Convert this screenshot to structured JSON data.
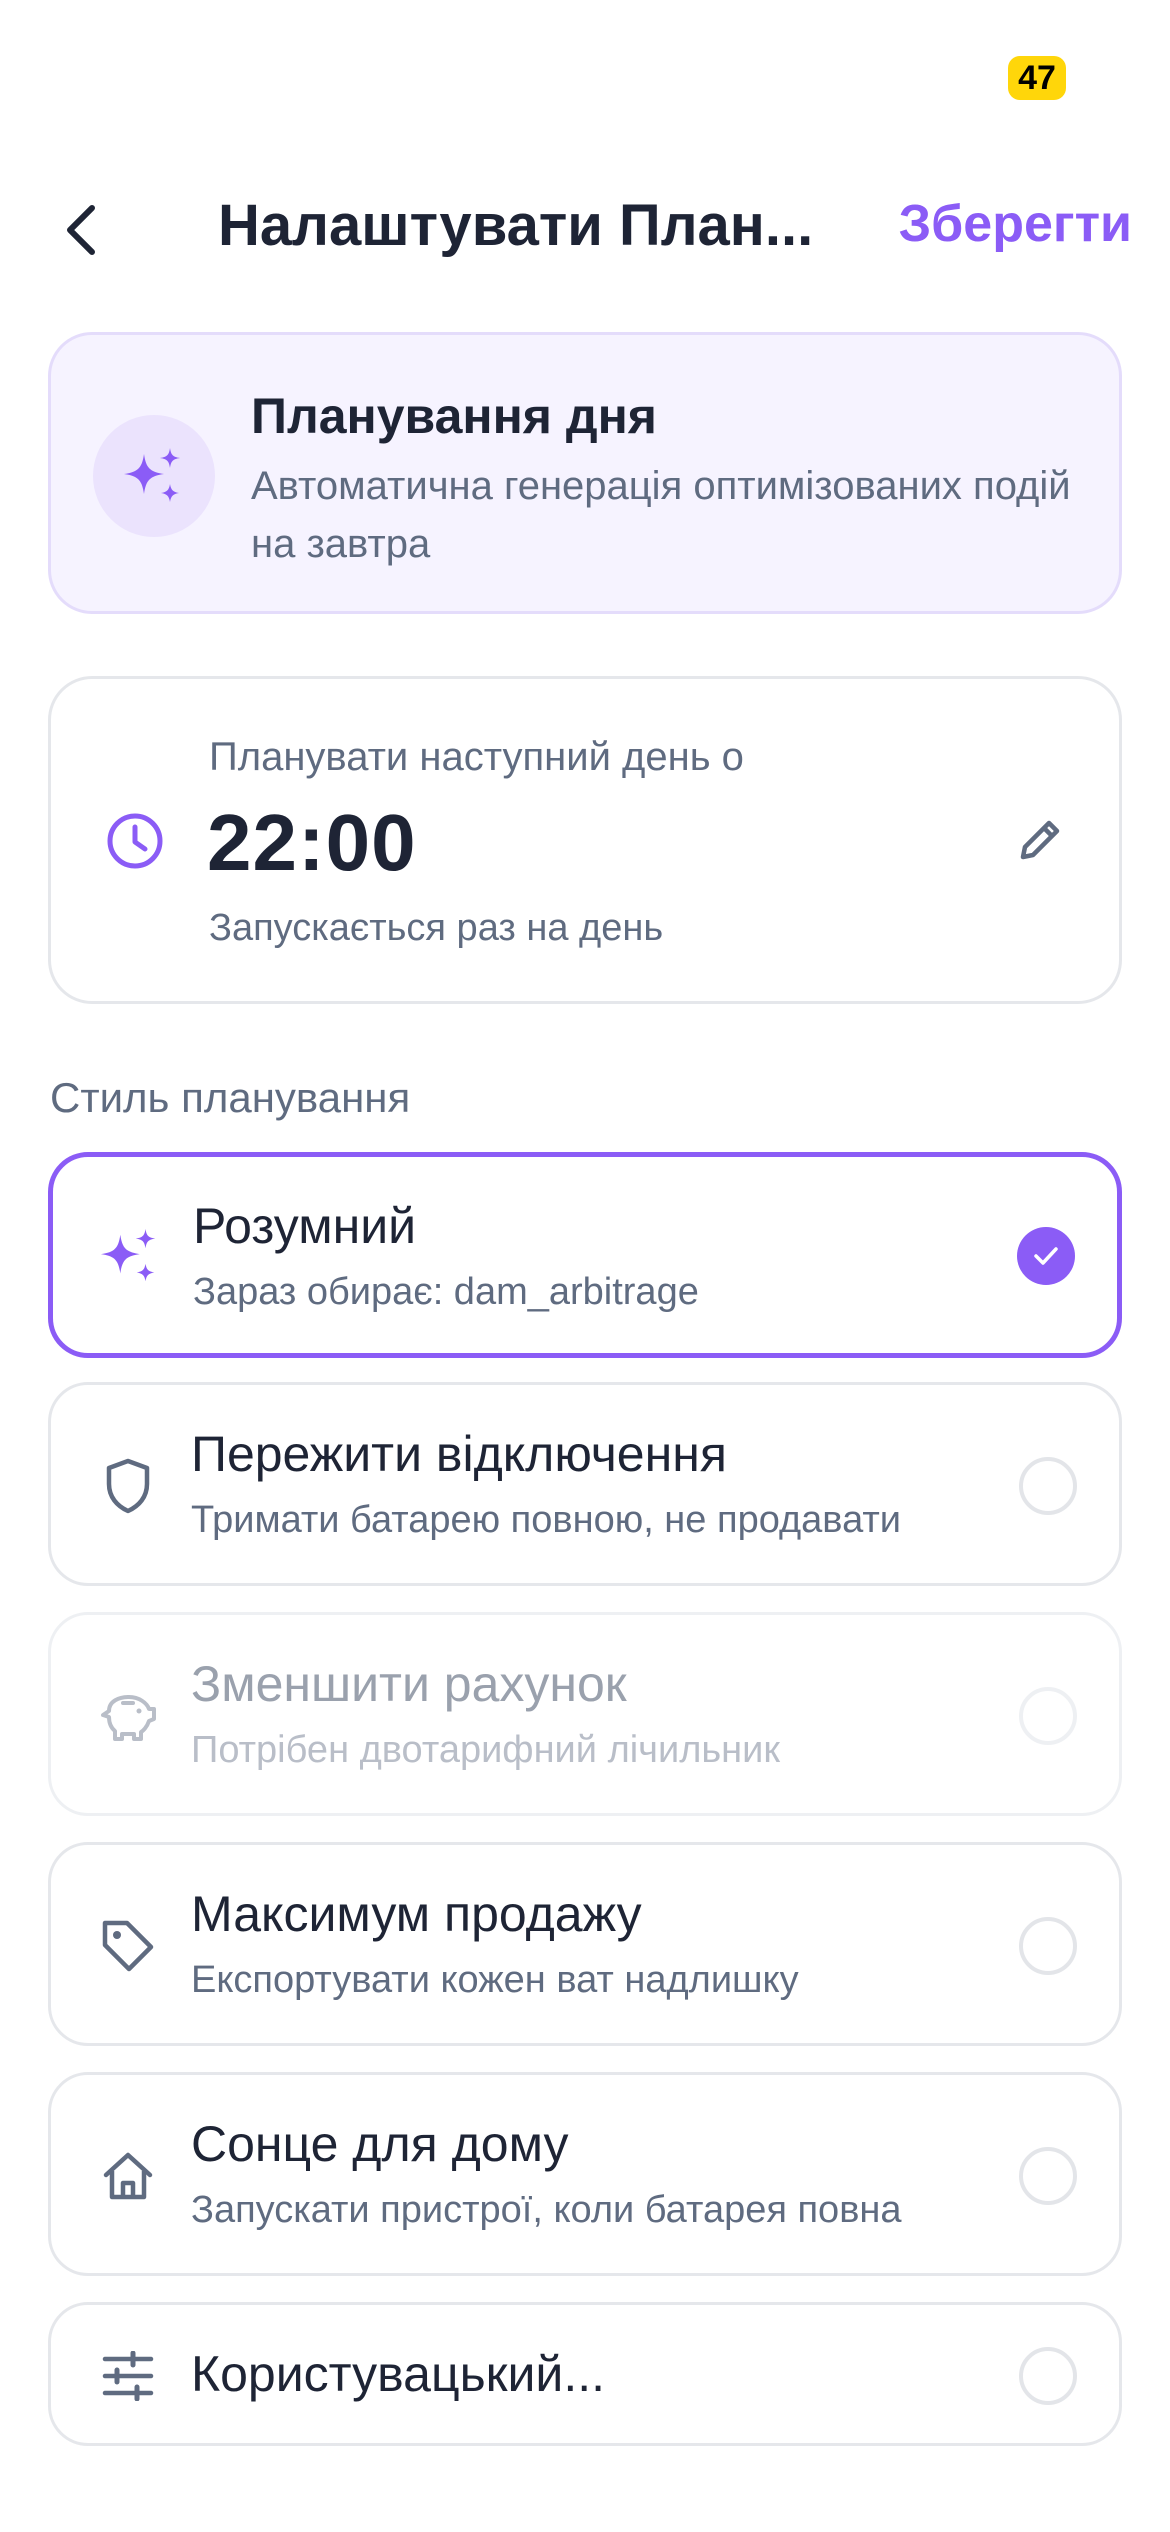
{
  "status_bar": {
    "battery": "47",
    "battery_color": "#ffd60a"
  },
  "nav": {
    "back_icon": "chevron-left-icon",
    "title": "Налаштувати План...",
    "save_label": "Зберегти"
  },
  "info_card": {
    "icon": "sparkles-icon",
    "title": "Планування дня",
    "description": "Автоматична генерація оптимізованих подій на завтра"
  },
  "schedule": {
    "icon": "clock-icon",
    "label": "Планувати наступний день о",
    "time": "22:00",
    "frequency": "Запускається раз на день",
    "edit_icon": "pencil-icon"
  },
  "section_title": "Стиль планування",
  "options": [
    {
      "icon": "sparkles-icon",
      "title": "Розумний",
      "subtitle": "Зараз обирає: dam_arbitrage",
      "selected": true,
      "disabled": false
    },
    {
      "icon": "shield-icon",
      "title": "Пережити відключення",
      "subtitle": "Тримати батарею повною, не продавати",
      "selected": false,
      "disabled": false
    },
    {
      "icon": "piggy-bank-icon",
      "title": "Зменшити рахунок",
      "subtitle": "Потрібен двотарифний лічильник",
      "selected": false,
      "disabled": true
    },
    {
      "icon": "tag-icon",
      "title": "Максимум продажу",
      "subtitle": "Експортувати кожен ват надлишку",
      "selected": false,
      "disabled": false
    },
    {
      "icon": "home-icon",
      "title": "Сонце для дому",
      "subtitle": "Запускати пристрої, коли батарея повна",
      "selected": false,
      "disabled": false
    },
    {
      "icon": "sliders-icon",
      "title": "Користувацький...",
      "subtitle": "",
      "selected": false,
      "disabled": false
    }
  ],
  "colors": {
    "accent": "#8b5cf6",
    "text_primary": "#1e2435",
    "text_secondary": "#5f6b80",
    "card_border": "#e5e7eb",
    "info_bg": "#f6f3ff"
  }
}
